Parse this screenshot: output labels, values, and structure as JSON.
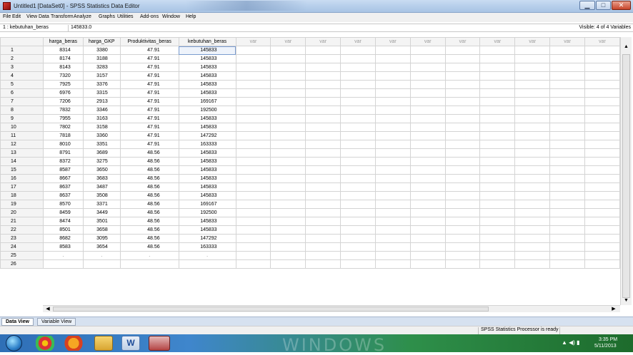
{
  "window": {
    "title": "Untitled1 [DataSet0] - SPSS Statistics Data Editor",
    "minimize_glyph": "▁",
    "maximize_glyph": "□",
    "close_glyph": "✕"
  },
  "menu": [
    "File",
    "Edit",
    "View",
    "Data",
    "Transform",
    "Analyze",
    "Graphs",
    "Utilities",
    "Add-ons",
    "Window",
    "Help"
  ],
  "cell_editor": {
    "reference": "1 : kebutuhan_beras",
    "value": "145833.0",
    "visible_info": "Visible: 4 of 4 Variables"
  },
  "columns": [
    "harga_beras",
    "harga_GKP",
    "Produktivitas_beras",
    "kebutuhan_beras",
    "var",
    "var",
    "var",
    "var",
    "var",
    "var",
    "var",
    "var",
    "var",
    "var",
    "var"
  ],
  "rows": [
    [
      "1",
      "8314",
      "3380",
      "47.91",
      "145833"
    ],
    [
      "2",
      "8174",
      "3188",
      "47.91",
      "145833"
    ],
    [
      "3",
      "8143",
      "3283",
      "47.91",
      "145833"
    ],
    [
      "4",
      "7320",
      "3157",
      "47.91",
      "145833"
    ],
    [
      "5",
      "7925",
      "3376",
      "47.91",
      "145833"
    ],
    [
      "6",
      "6976",
      "3315",
      "47.91",
      "145833"
    ],
    [
      "7",
      "7206",
      "2913",
      "47.91",
      "169167"
    ],
    [
      "8",
      "7832",
      "3346",
      "47.91",
      "192500"
    ],
    [
      "9",
      "7955",
      "3163",
      "47.91",
      "145833"
    ],
    [
      "10",
      "7802",
      "3158",
      "47.91",
      "145833"
    ],
    [
      "11",
      "7818",
      "3360",
      "47.91",
      "147292"
    ],
    [
      "12",
      "8010",
      "3351",
      "47.91",
      "163333"
    ],
    [
      "13",
      "8791",
      "3689",
      "48.56",
      "145833"
    ],
    [
      "14",
      "8372",
      "3275",
      "48.56",
      "145833"
    ],
    [
      "15",
      "8587",
      "3650",
      "48.56",
      "145833"
    ],
    [
      "16",
      "8667",
      "3683",
      "48.56",
      "145833"
    ],
    [
      "17",
      "8637",
      "3487",
      "48.56",
      "145833"
    ],
    [
      "18",
      "8637",
      "3508",
      "48.56",
      "145833"
    ],
    [
      "19",
      "8570",
      "3371",
      "48.56",
      "169167"
    ],
    [
      "20",
      "8459",
      "3449",
      "48.56",
      "192500"
    ],
    [
      "21",
      "8474",
      "3501",
      "48.56",
      "145833"
    ],
    [
      "22",
      "8501",
      "3658",
      "48.56",
      "145833"
    ],
    [
      "23",
      "8682",
      "3095",
      "48.56",
      "147292"
    ],
    [
      "24",
      "8583",
      "3654",
      "48.56",
      "163333"
    ],
    [
      "25",
      ".",
      ".",
      ".",
      "."
    ],
    [
      "26",
      "",
      "",
      "",
      ""
    ]
  ],
  "tabs": [
    "Data View",
    "Variable View"
  ],
  "status": "SPSS Statistics  Processor is ready",
  "taskbar": {
    "watermark": "WINDOWS",
    "word_label": "W",
    "tray_icons": "▲  ◀)  ▮",
    "time": "3:35 PM",
    "date": "5/11/2013"
  },
  "scroll_glyphs": {
    "up": "▲",
    "down": "▼",
    "left": "◀",
    "right": "▶"
  }
}
